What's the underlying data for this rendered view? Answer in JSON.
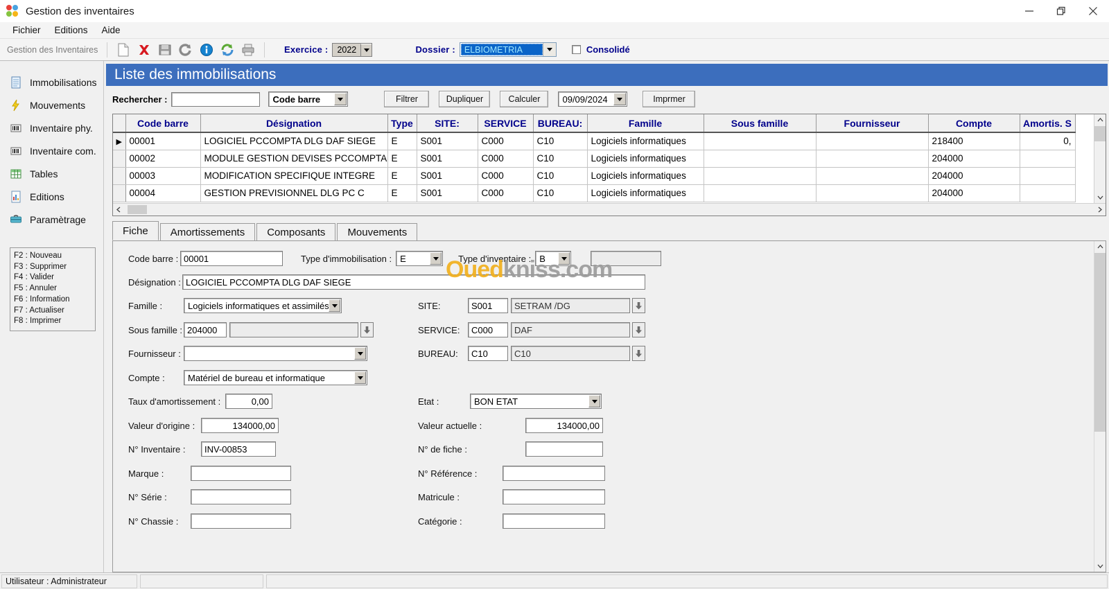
{
  "window": {
    "title": "Gestion des inventaires",
    "minimize": "minimize-icon",
    "restore": "restore-icon",
    "close": "close-icon"
  },
  "menu": {
    "items": [
      "Fichier",
      "Editions",
      "Aide"
    ]
  },
  "toolbar": {
    "module_label": "Gestion des Inventaires",
    "icons": [
      "new-document-icon",
      "delete-icon",
      "save-icon",
      "undo-icon",
      "info-icon",
      "refresh-icon",
      "print-icon"
    ],
    "exercice_label": "Exercice :",
    "exercice_value": "2022",
    "dossier_label": "Dossier :",
    "dossier_value": "ELBIOMETRIA",
    "consolide_label": "Consolidé",
    "consolide_checked": false
  },
  "sidebar": {
    "items": [
      {
        "label": "Immobilisations",
        "icon": "document-icon"
      },
      {
        "label": "Mouvements",
        "icon": "lightning-icon"
      },
      {
        "label": "Inventaire phy.",
        "icon": "barcode-icon"
      },
      {
        "label": "Inventaire com.",
        "icon": "barcode-icon"
      },
      {
        "label": "Tables",
        "icon": "table-icon"
      },
      {
        "label": "Editions",
        "icon": "report-icon"
      },
      {
        "label": "Paramètrage",
        "icon": "toolbox-icon"
      }
    ],
    "shortcuts": [
      "F2 : Nouveau",
      "F3 : Supprimer",
      "F4 : Valider",
      "F5 : Annuler",
      "F6 : Information",
      "F7 : Actualiser",
      "F8 : Imprimer"
    ]
  },
  "page": {
    "title": "Liste des immobilisations",
    "search_label": "Rechercher :",
    "search_value": "",
    "search_field_value": "Code barre",
    "buttons": {
      "filtrer": "Filtrer",
      "dupliquer": "Dupliquer",
      "calculer": "Calculer",
      "imprimer": "Imprmer"
    },
    "date_value": "09/09/2024"
  },
  "grid": {
    "columns": [
      "Code barre",
      "Désignation",
      "Type",
      "SITE:",
      "SERVICE",
      "BUREAU:",
      "Famille",
      "Sous famille",
      "Fournisseur",
      "Compte",
      "Amortis. S"
    ],
    "rows": [
      {
        "selected": true,
        "code": "00001",
        "designation": "LOGICIEL PCCOMPTA DLG DAF SIEGE",
        "type": "E",
        "site": "S001",
        "service": "C000",
        "bureau": "C10",
        "famille": "Logiciels informatiques",
        "sous_famille": "",
        "fournisseur": "",
        "compte": "218400",
        "amortis": "0,"
      },
      {
        "selected": false,
        "code": "00002",
        "designation": "MODULE GESTION DEVISES PCCOMPTA",
        "type": "E",
        "site": "S001",
        "service": "C000",
        "bureau": "C10",
        "famille": "Logiciels informatiques",
        "sous_famille": "",
        "fournisseur": "",
        "compte": "204000",
        "amortis": ""
      },
      {
        "selected": false,
        "code": "00003",
        "designation": "MODIFICATION SPECIFIQUE INTEGRE",
        "type": "E",
        "site": "S001",
        "service": "C000",
        "bureau": "C10",
        "famille": "Logiciels informatiques",
        "sous_famille": "",
        "fournisseur": "",
        "compte": "204000",
        "amortis": ""
      },
      {
        "selected": false,
        "code": "00004",
        "designation": "GESTION PREVISIONNEL DLG PC C",
        "type": "E",
        "site": "S001",
        "service": "C000",
        "bureau": "C10",
        "famille": "Logiciels informatiques",
        "sous_famille": "",
        "fournisseur": "",
        "compte": "204000",
        "amortis": ""
      }
    ]
  },
  "tabs": [
    {
      "label": "Fiche",
      "active": true
    },
    {
      "label": "Amortissements",
      "active": false
    },
    {
      "label": "Composants",
      "active": false
    },
    {
      "label": "Mouvements",
      "active": false
    }
  ],
  "fiche": {
    "code_barre_label": "Code barre :",
    "code_barre_value": "00001",
    "type_immo_label": "Type d'immobilisation :",
    "type_immo_value": "E",
    "type_inv_label": "Type d'inventaire :",
    "type_inv_value": "B",
    "extra_value": "",
    "designation_label": "Désignation :",
    "designation_value": "LOGICIEL PCCOMPTA DLG DAF SIEGE",
    "famille_label": "Famille :",
    "famille_value": "Logiciels informatiques et assimilés ,",
    "sous_famille_label": "Sous famille :",
    "sous_famille_code": "204000",
    "sous_famille_value": "",
    "fournisseur_label": "Fournisseur :",
    "fournisseur_value": "",
    "compte_label": "Compte :",
    "compte_value": "Matériel de bureau et informatique",
    "site_label": "SITE:",
    "site_code": "S001",
    "site_value": "SETRAM /DG",
    "service_label": "SERVICE:",
    "service_code": "C000",
    "service_value": "DAF",
    "bureau_label": "BUREAU:",
    "bureau_code": "C10",
    "bureau_value": "C10",
    "taux_label": "Taux d'amortissement :",
    "taux_value": "0,00",
    "etat_label": "Etat :",
    "etat_value": "BON ETAT",
    "valeur_origine_label": "Valeur d'origine :",
    "valeur_origine_value": "134000,00",
    "valeur_actuelle_label": "Valeur actuelle :",
    "valeur_actuelle_value": "134000,00",
    "num_inventaire_label": "N° Inventaire :",
    "num_inventaire_value": "INV-00853",
    "num_fiche_label": "N° de fiche :",
    "num_fiche_value": "",
    "marque_label": "Marque :",
    "marque_value": "",
    "num_reference_label": "N° Référence :",
    "num_reference_value": "",
    "num_serie_label": "N° Série :",
    "num_serie_value": "",
    "matricule_label": "Matricule :",
    "matricule_value": "",
    "num_chassie_label": "N° Chassie :",
    "num_chassie_value": "",
    "categorie_label": "Catégorie :",
    "categorie_value": ""
  },
  "watermark": {
    "part1": "Oued",
    "part2": "kniss.com"
  },
  "statusbar": {
    "user": "Utilisateur : Administrateur",
    "cell2": "",
    "cell3": ""
  },
  "colors": {
    "header_blue": "#3c6ebd",
    "grid_header_text": "#00008b",
    "accent_label": "#00008b",
    "selection": "#0a64c8"
  }
}
